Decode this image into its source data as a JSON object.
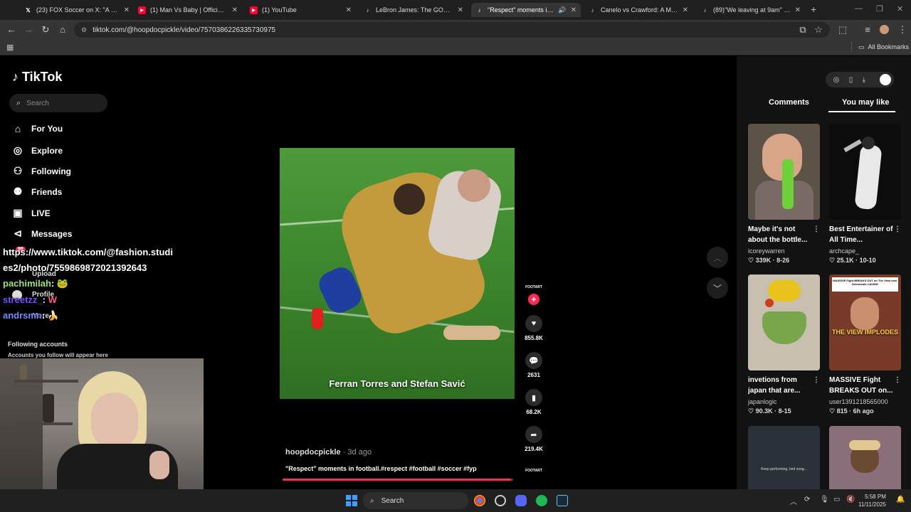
{
  "browser": {
    "tabs": [
      {
        "title": "(23) FOX Soccer on X: \"A BICYC",
        "icon": "x-logo-icon",
        "active": false
      },
      {
        "title": "(1) Man Vs Baby | Official Traile",
        "icon": "youtube-icon",
        "active": false
      },
      {
        "title": "(1) YouTube",
        "icon": "youtube-icon",
        "active": false
      },
      {
        "title": "LeBron James: The GOAT Debat",
        "icon": "tiktok-icon",
        "active": false
      },
      {
        "title": "\"Respect\" moments in footl",
        "icon": "tiktok-icon",
        "active": true
      },
      {
        "title": "Canelo vs Crawford: A Must-W",
        "icon": "tiktok-icon",
        "active": false
      },
      {
        "title": "(89)\"We leaving at 9am\" ho I'm",
        "icon": "tiktok-icon",
        "active": false
      }
    ],
    "url": "tiktok.com/@hoopdocpickle/video/7570386226335730975",
    "bookmarks_label": "All Bookmarks"
  },
  "tiktok": {
    "logo": "TikTok",
    "search_placeholder": "Search",
    "nav": [
      {
        "label": "For You",
        "icon": "home-icon"
      },
      {
        "label": "Explore",
        "icon": "compass-icon"
      },
      {
        "label": "Following",
        "icon": "following-icon"
      },
      {
        "label": "Friends",
        "icon": "friends-icon"
      },
      {
        "label": "LIVE",
        "icon": "live-icon"
      },
      {
        "label": "Messages",
        "icon": "messages-icon"
      }
    ],
    "messages_badge": "99",
    "hidden_nav": {
      "upload": "Upload",
      "profile": "Profile",
      "more": "More"
    },
    "following_title": "Following accounts",
    "following_sub": "Accounts you follow will appear here"
  },
  "chat": {
    "line1": "https://www.tiktok.com/@fashion.studi",
    "line2": "es2/photo/7559869872021392643",
    "user1": "pachimilah",
    "msg1": "🐸",
    "user2": "streetzz_",
    "msg2": "W",
    "user3": "andrsmn",
    "msg3": "🍌"
  },
  "video": {
    "caption": "Ferran Torres and Stefan Savić",
    "progress": 0.99,
    "author": "hoopdocpickle",
    "age": "3d ago",
    "description": "\"Respect\" moments in football.#respect #football #soccer #fyp",
    "source_tag": "FOOTART",
    "likes": "855.8K",
    "comments": "2631",
    "saves": "68.2K",
    "shares": "219.4K"
  },
  "right_panel": {
    "tabs": [
      "Comments",
      "You may like"
    ],
    "active_tab": "You may like",
    "cards": [
      {
        "title": "Maybe it's not about the bottle...",
        "author": "icoreywarren",
        "likes": "339K",
        "date": "8-26",
        "thumb_color": "#5b5248"
      },
      {
        "title": "Best Entertainer of All Time...",
        "author": "archcape_",
        "likes": "25.1K",
        "date": "10-10",
        "thumb_color": "#0c0c0c"
      },
      {
        "title": "invetions from japan that are...",
        "author": "japanlogic",
        "likes": "90.3K",
        "date": "8-15",
        "thumb_color": "#c8bfb0"
      },
      {
        "title": "MASSIVE Fight BREAKS OUT on...",
        "author": "user1391218565000",
        "likes": "815",
        "date": "6h ago",
        "thumb_color": "#7a3a2a",
        "overlay": "THE VIEW IMPLODES",
        "top_text": "MASSIVE Fight BREAKS OUT on The View over Democrats CAVING"
      },
      {
        "title": "",
        "author": "",
        "likes": "",
        "date": "",
        "thumb_color": "#2a3138",
        "overlay": "Keep performing, bird song..."
      },
      {
        "title": "",
        "author": "",
        "likes": "",
        "date": "",
        "thumb_color": "#8a6f7a"
      }
    ]
  },
  "taskbar": {
    "search": "Search",
    "time": "5:58 PM",
    "date": "11/11/2025"
  }
}
